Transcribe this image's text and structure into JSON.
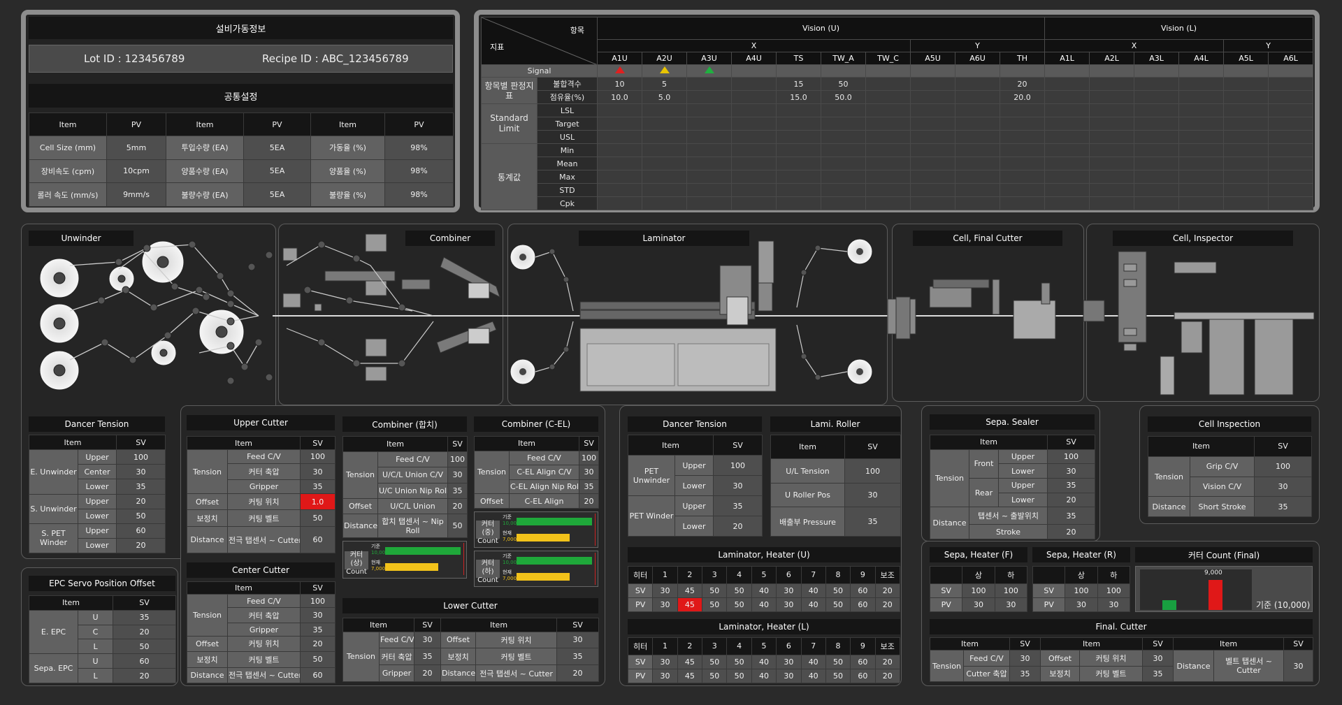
{
  "equipment_info": {
    "title": "설비가동정보",
    "lot_id": "Lot ID : 123456789",
    "recipe_id": "Recipe ID : ABC_123456789",
    "common_title": "공통설정",
    "headers": [
      "Item",
      "PV",
      "Item",
      "PV",
      "Item",
      "PV"
    ],
    "rows": [
      [
        "Cell Size (mm)",
        "5mm",
        "투입수량 (EA)",
        "5EA",
        "가동율 (%)",
        "98%"
      ],
      [
        "장비속도 (cpm)",
        "10cpm",
        "양품수량 (EA)",
        "5EA",
        "양품율 (%)",
        "98%"
      ],
      [
        "롤러 속도 (mm/s)",
        "9mm/s",
        "불량수량 (EA)",
        "5EA",
        "불량율 (%)",
        "98%"
      ]
    ]
  },
  "vision": {
    "corner_top": "항목",
    "corner_bottom": "지표",
    "group_u": "Vision (U)",
    "group_l": "Vision (L)",
    "x": "X",
    "y": "Y",
    "columns": [
      "A1U",
      "A2U",
      "A3U",
      "A4U",
      "TS",
      "TW_A",
      "TW_C",
      "A5U",
      "A6U",
      "TH",
      "A1L",
      "A2L",
      "A3L",
      "A4L",
      "A5L",
      "A6L"
    ],
    "signal_label": "Signal",
    "signals": [
      "red-triangle-icon",
      "yellow-triangle-icon",
      "green-triangle-icon"
    ],
    "signal_colors": {
      "red": "#e02020",
      "yellow": "#e8c400",
      "green": "#20b040"
    },
    "judge_group": "항목별 판정지표",
    "defect_label": "불합격수",
    "rate_label": "점유율(%)",
    "defect": [
      "10",
      "5",
      "",
      "",
      "15",
      "50",
      "",
      "",
      "",
      "20",
      "",
      "",
      "",
      "",
      "",
      ""
    ],
    "rate": [
      "10.0",
      "5.0",
      "",
      "",
      "15.0",
      "50.0",
      "",
      "",
      "",
      "20.0",
      "",
      "",
      "",
      "",
      "",
      ""
    ],
    "standard_group": "Standard Limit",
    "standard_rows": [
      "LSL",
      "Target",
      "USL"
    ],
    "stats_group": "통계값",
    "stats_rows": [
      "Min",
      "Mean",
      "Max",
      "STD",
      "Cpk"
    ]
  },
  "sections": {
    "unwinder": "Unwinder",
    "combiner": "Combiner",
    "laminator": "Laminator",
    "final_cutter": "Cell, Final Cutter",
    "inspector": "Cell, Inspector"
  },
  "dancer_tension": {
    "title": "Dancer Tension",
    "h_item": "Item",
    "h_sv": "SV",
    "g1": "E. Unwinder",
    "g2": "S. Unwinder",
    "g3": "S. PET Winder",
    "upper": "Upper",
    "center": "Center",
    "lower": "Lower",
    "v1": "100",
    "v2": "30",
    "v3": "35",
    "v4": "20",
    "v5": "50",
    "v6": "60",
    "v7": "20"
  },
  "epc": {
    "title": "EPC Servo Position Offset",
    "h_item": "Item",
    "h_sv": "SV",
    "g1": "E. EPC",
    "g2": "Sepa. EPC",
    "u": "U",
    "c": "C",
    "l": "L",
    "v1": "35",
    "v2": "20",
    "v3": "50",
    "v4": "60",
    "v5": "20"
  },
  "upper_cutter": {
    "title": "Upper Cutter",
    "h_item": "Item",
    "h_sv": "SV",
    "tension": "Tension",
    "offset": "Offset",
    "bojeong": "보정치",
    "distance": "Distance",
    "feed": "Feed C/V",
    "cutter_axis": "커터 축압",
    "gripper": "Gripper",
    "cut_pos": "커팅 위치",
    "cut_belt": "커팅 벨트",
    "sensor_cutter": "전극 탭센서 ~ Cutter",
    "v1": "100",
    "v2": "30",
    "v3": "35",
    "v4": "1.0",
    "v5": "50",
    "v6": "60"
  },
  "center_cutter": {
    "title": "Center Cutter",
    "h_item": "Item",
    "h_sv": "SV",
    "tension": "Tension",
    "offset": "Offset",
    "bojeong": "보정치",
    "distance": "Distance",
    "feed": "Feed C/V",
    "cutter_axis": "커터 축압",
    "gripper": "Gripper",
    "cut_pos": "커팅 위치",
    "cut_belt": "커팅 벨트",
    "sensor_cutter": "전극 탭센서 ~ Cutter",
    "v1": "100",
    "v2": "30",
    "v3": "35",
    "v4": "20",
    "v5": "50",
    "v6": "60"
  },
  "combiner_hapchi": {
    "title": "Combiner (합치)",
    "h_item": "Item",
    "h_sv": "SV",
    "tension": "Tension",
    "offset": "Offset",
    "distance": "Distance",
    "r1": "Feed C/V",
    "r2": "U/C/L Union C/V",
    "r3": "U/C Union Nip Roll",
    "r4": "U/C/L Union",
    "r5": "합치 탭센서 ~ Nip Roll",
    "v1": "100",
    "v2": "30",
    "v3": "35",
    "v4": "20",
    "v5": "50"
  },
  "combiner_cel": {
    "title": "Combiner (C-EL)",
    "h_item": "Item",
    "h_sv": "SV",
    "tension": "Tension",
    "offset": "Offset",
    "r1": "Feed C/V",
    "r2": "C-EL Align C/V",
    "r3": "C-EL Align Nip Roll",
    "r4": "C-EL Align",
    "v1": "100",
    "v2": "30",
    "v3": "35",
    "v4": "20"
  },
  "counts": {
    "upper": "커터(상) Count",
    "middle": "커터(중) Count",
    "lower": "커터(하) Count",
    "ref_label": "기준",
    "ref_value": "10,000",
    "cur_label": "현재",
    "cur_value": "7,000",
    "ref": 10000,
    "current": 7000,
    "ref_color": "#1fa83a",
    "cur_color": "#f2c21a"
  },
  "lower_cutter": {
    "title": "Lower Cutter",
    "h_item": "Item",
    "h_sv": "SV",
    "tension": "Tension",
    "offset": "Offset",
    "bojeong": "보정치",
    "distance": "Distance",
    "feed": "Feed C/V",
    "cutter_axis": "커터 축압",
    "gripper": "Gripper",
    "cut_pos": "커팅 위치",
    "cut_belt": "커팅 벨트",
    "sensor_cutter": "전극 탭센서 ~ Cutter",
    "v1": "30",
    "v2": "35",
    "v3": "20",
    "v4": "30",
    "v5": "35",
    "v6": "20"
  },
  "dancer_tension2": {
    "title": "Dancer Tension",
    "h_item": "Item",
    "h_sv": "SV",
    "g1": "PET Unwinder",
    "g2": "PET Winder",
    "upper": "Upper",
    "lower": "Lower",
    "v1": "100",
    "v2": "30",
    "v3": "35",
    "v4": "20"
  },
  "lami_roller": {
    "title": "Lami. Roller",
    "h_item": "Item",
    "h_sv": "SV",
    "r1": "U/L Tension",
    "r2": "U Roller Pos",
    "r3": "배출부 Pressure",
    "v1": "100",
    "v2": "30",
    "v3": "35"
  },
  "heater_u": {
    "title": "Laminator, Heater (U)",
    "cols": [
      "히터",
      "1",
      "2",
      "3",
      "4",
      "5",
      "6",
      "7",
      "8",
      "9",
      "보조"
    ],
    "sv": [
      "SV",
      "30",
      "45",
      "50",
      "50",
      "40",
      "30",
      "40",
      "50",
      "60",
      "20"
    ],
    "pv": [
      "PV",
      "30",
      "45",
      "50",
      "50",
      "40",
      "30",
      "40",
      "50",
      "60",
      "20"
    ]
  },
  "heater_l": {
    "title": "Laminator, Heater (L)",
    "cols": [
      "히터",
      "1",
      "2",
      "3",
      "4",
      "5",
      "6",
      "7",
      "8",
      "9",
      "보조"
    ],
    "sv": [
      "SV",
      "30",
      "45",
      "50",
      "50",
      "40",
      "30",
      "40",
      "50",
      "60",
      "20"
    ],
    "pv": [
      "PV",
      "30",
      "45",
      "50",
      "50",
      "40",
      "30",
      "40",
      "50",
      "60",
      "20"
    ]
  },
  "sepa_sealer": {
    "title": "Sepa. Sealer",
    "h_item": "Item",
    "h_sv": "SV",
    "tension": "Tension",
    "distance": "Distance",
    "front": "Front",
    "rear": "Rear",
    "upper": "Upper",
    "lower": "Lower",
    "sensor": "탭센서 ~ 출발위치",
    "stroke": "Stroke",
    "v1": "100",
    "v2": "30",
    "v3": "35",
    "v4": "20",
    "v5": "35",
    "v6": "20"
  },
  "cell_inspection": {
    "title": "Cell Inspection",
    "h_item": "Item",
    "h_sv": "SV",
    "tension": "Tension",
    "distance": "Distance",
    "r1": "Grip C/V",
    "r2": "Vision C/V",
    "r3": "Short Stroke",
    "v1": "100",
    "v2": "30",
    "v3": "35"
  },
  "sepa_heater_f": {
    "title": "Sepa, Heater (F)",
    "c1": "상",
    "c2": "하",
    "sv": "SV",
    "pv": "PV",
    "v1": "100",
    "v2": "100",
    "v3": "30",
    "v4": "30"
  },
  "sepa_heater_r": {
    "title": "Sepa, Heater (R)",
    "c1": "상",
    "c2": "하",
    "sv": "SV",
    "pv": "PV",
    "v1": "100",
    "v2": "100",
    "v3": "30",
    "v4": "30"
  },
  "cutter_count_final": {
    "title": "커터 Count (Final)",
    "top_label": "9,000",
    "ref_text": "기준 (10,000)",
    "green_value": 3000,
    "red_value": 9000,
    "max": 10000
  },
  "final_cutter": {
    "title": "Final. Cutter",
    "h_item": "Item",
    "h_sv": "SV",
    "tension": "Tension",
    "offset": "Offset",
    "bojeong": "보정치",
    "distance": "Distance",
    "feed": "Feed C/V",
    "cutter_axis": "Cutter 축압",
    "cut_pos": "커팅 위치",
    "cut_belt": "커팅 벨트",
    "sensor_cutter": "벨트 탭센서 ~ Cutter",
    "v1": "30",
    "v2": "35",
    "v3": "30",
    "v4": "35",
    "v5": "30"
  }
}
